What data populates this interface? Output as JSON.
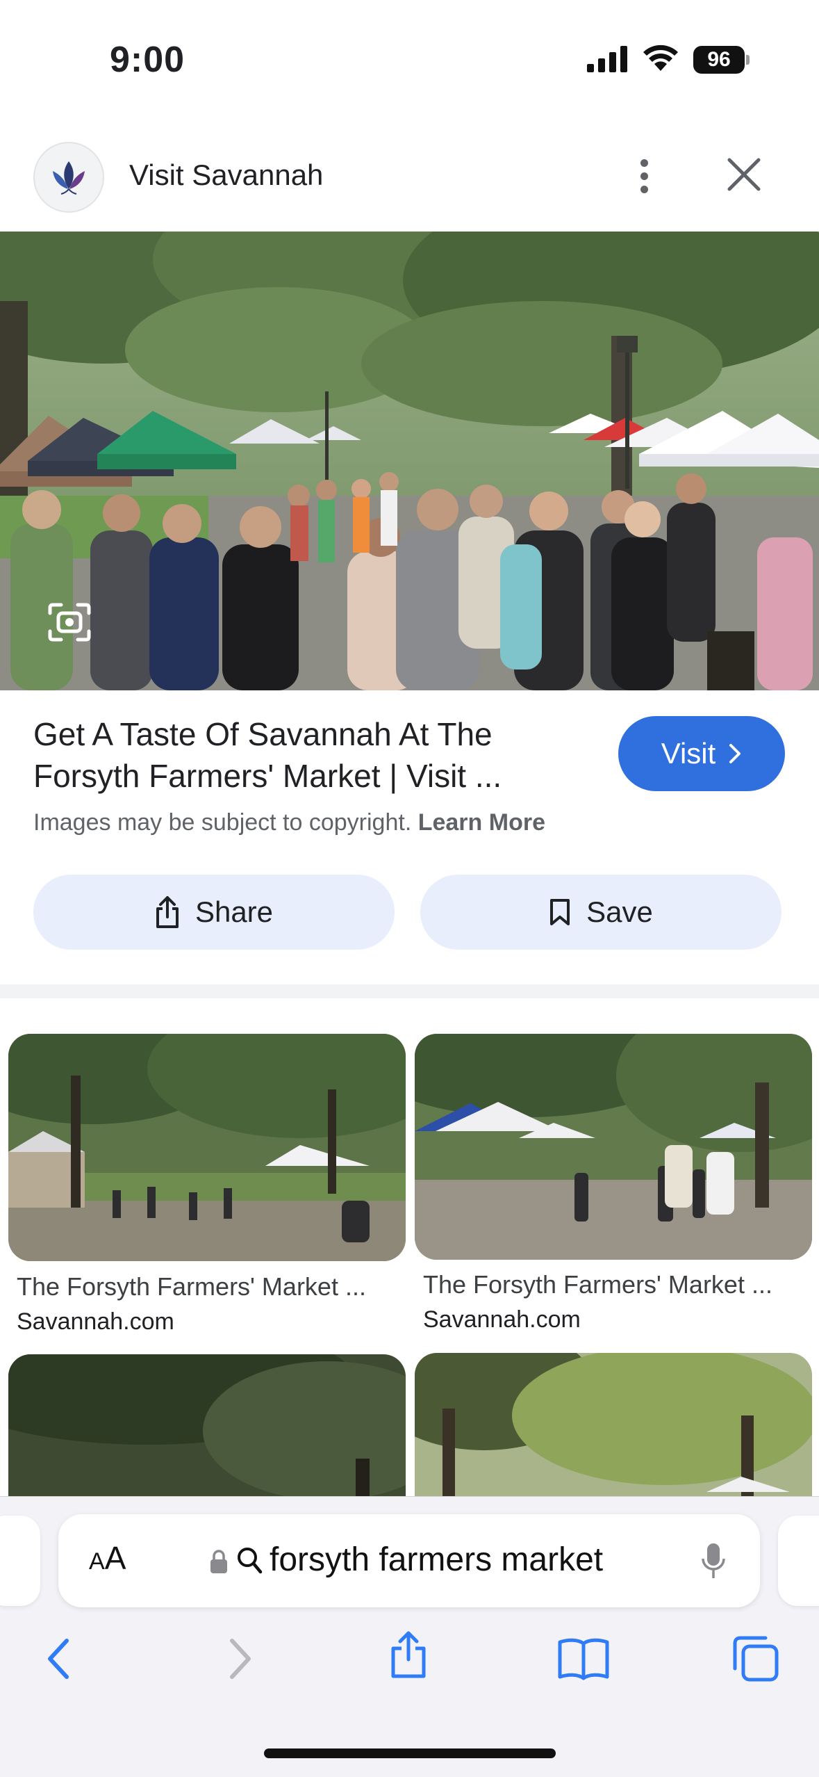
{
  "status_bar": {
    "time": "9:00",
    "battery": "96"
  },
  "header": {
    "site_name": "Visit Savannah"
  },
  "result": {
    "title": "Get A Taste Of Savannah At The Forsyth Farmers' Market | Visit ...",
    "visit_label": "Visit",
    "copyright_text": "Images may be subject to copyright.",
    "learn_more": "Learn More",
    "share_label": "Share",
    "save_label": "Save"
  },
  "related": [
    {
      "title": "The Forsyth Farmers' Market ...",
      "source": "Savannah.com"
    },
    {
      "title": "The Forsyth Farmers' Market ...",
      "source": "Savannah.com"
    }
  ],
  "browser": {
    "text_size_label_small": "A",
    "text_size_label_large": "A",
    "address_text": "forsyth farmers market"
  },
  "colors": {
    "accent": "#2f6fde",
    "pill_bg": "#e8eefc",
    "toolbar_blue": "#2f7cf6"
  }
}
